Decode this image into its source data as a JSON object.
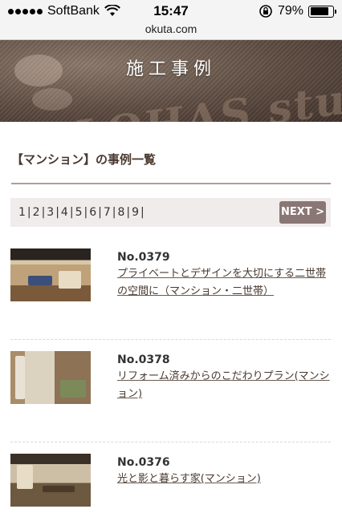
{
  "status_bar": {
    "carrier": "SoftBank",
    "time": "15:47",
    "battery_percent": "79%",
    "battery_level": 0.79
  },
  "browser": {
    "url": "okuta.com"
  },
  "hero": {
    "title": "施工事例",
    "sign_text": "LOHAS studio"
  },
  "section": {
    "title": "【マンション】の事例一覧"
  },
  "pagination": {
    "pages": [
      "1",
      "2",
      "3",
      "4",
      "5",
      "6",
      "7",
      "8",
      "9"
    ],
    "next_label": "NEXT >"
  },
  "cases": [
    {
      "number": "No.0379",
      "title": "プライベートとデザインを大切にする二世帯の空間に（マンション・二世帯）"
    },
    {
      "number": "No.0378",
      "title": "リフォーム済みからのこだわりプラン(マンション)"
    },
    {
      "number": "No.0376",
      "title": "光と影と暮らす家(マンション)"
    }
  ]
}
